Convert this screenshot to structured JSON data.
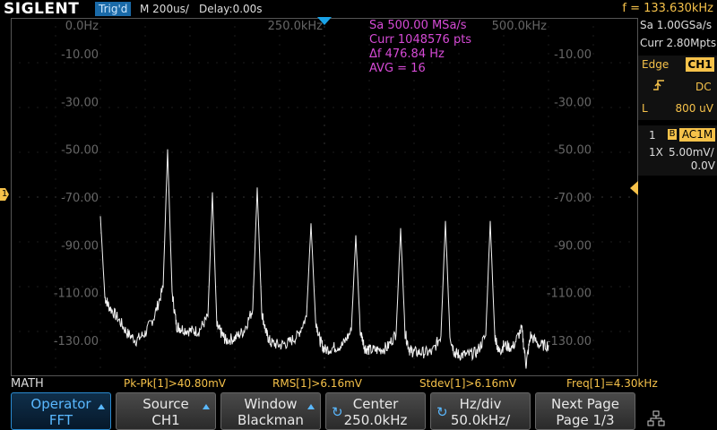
{
  "header": {
    "logo": "SIGLENT",
    "trig_status": "Trig'd",
    "timebase": "M 200us/",
    "delay": "Delay:0.00s",
    "frequency": "f = 133.630kHz"
  },
  "fft_info": {
    "sample_rate": "Sa 500.00 MSa/s",
    "points": "Curr 1048576 pts",
    "delta_f": "Δf 476.84 Hz",
    "avg": "AVG = 16"
  },
  "x_labels": [
    "0.0Hz",
    "250.0kHz",
    "500.0kHz"
  ],
  "y_labels_left": [
    "-10.00",
    "-30.00",
    "-50.00",
    "-70.00",
    "-90.00",
    "-110.00",
    "-130.00"
  ],
  "y_labels_right": [
    "-10.00",
    "-30.00",
    "-50.00",
    "-70.00",
    "-90.00",
    "-110.00",
    "-130.00"
  ],
  "chart_data": {
    "type": "line",
    "title": "",
    "xlabel": "",
    "ylabel": "",
    "xlim": [
      0,
      500000
    ],
    "ylim": [
      5,
      -145
    ],
    "series": [
      {
        "x": [
          0,
          5000,
          10000,
          20000,
          30000,
          40000,
          50000,
          60000,
          70000,
          75000,
          80000,
          85000,
          90000,
          100000,
          110000,
          120000,
          125000,
          130000,
          135000,
          140000,
          150000,
          160000,
          170000,
          175000,
          180000,
          185000,
          190000,
          200000,
          210000,
          220000,
          230000,
          235000,
          240000,
          245000,
          250000,
          260000,
          270000,
          280000,
          285000,
          290000,
          295000,
          300000,
          310000,
          320000,
          330000,
          335000,
          340000,
          345000,
          350000,
          360000,
          370000,
          380000,
          385000,
          390000,
          395000,
          400000,
          410000,
          420000,
          430000,
          435000,
          440000,
          445000,
          450000,
          460000,
          470000,
          475000,
          480000,
          490000,
          500000
        ],
        "y": [
          -78,
          -112,
          -116,
          -121,
          -127,
          -130,
          -127,
          -120,
          -108,
          -50,
          -110,
          -124,
          -125,
          -126,
          -126,
          -120,
          -68,
          -124,
          -127,
          -130,
          -129,
          -126,
          -117,
          -66,
          -118,
          -127,
          -131,
          -132,
          -131,
          -128,
          -120,
          -81,
          -121,
          -130,
          -134,
          -133,
          -132,
          -126,
          -86,
          -126,
          -133,
          -134,
          -134,
          -133,
          -127,
          -83,
          -127,
          -134,
          -135,
          -135,
          -135,
          -128,
          -80,
          -128,
          -135,
          -136,
          -136,
          -135,
          -128,
          -80,
          -128,
          -135,
          -132,
          -133,
          -125,
          -140,
          -128,
          -132,
          -132
        ]
      }
    ],
    "grid": true
  },
  "trigger": {
    "sa": "Sa 1.00GSa/s",
    "curr": "Curr 2.80Mpts",
    "type": "Edge",
    "source": "CH1",
    "coupling": "DC",
    "level_label": "L",
    "level": "800 uV"
  },
  "channel": {
    "number": "1",
    "bw": "B",
    "coupling": "AC1M",
    "probe": "1X",
    "vdiv": "5.00mV/",
    "offset": "0.0V"
  },
  "markers": {
    "ch_marker": "1"
  },
  "measurements": {
    "label": "MATH",
    "items": [
      "Pk-Pk[1]>40.80mV",
      "RMS[1]>6.16mV",
      "Stdev[1]>6.16mV",
      "Freq[1]=4.30kHz"
    ]
  },
  "menu": {
    "operator": {
      "l1": "Operator",
      "l2": "FFT"
    },
    "source": {
      "l1": "Source",
      "l2": "CH1"
    },
    "window": {
      "l1": "Window",
      "l2": "Blackman"
    },
    "center": {
      "l1": "Center",
      "l2": "250.0kHz"
    },
    "hzdiv": {
      "l1": "Hz/div",
      "l2": "50.0kHz/"
    },
    "nextpage": {
      "l1": "Next Page",
      "l2": "Page 1/3"
    }
  },
  "colors": {
    "accent": "#f6c24a",
    "fft_text": "#d64ad6",
    "blue": "#1a6aa8"
  }
}
